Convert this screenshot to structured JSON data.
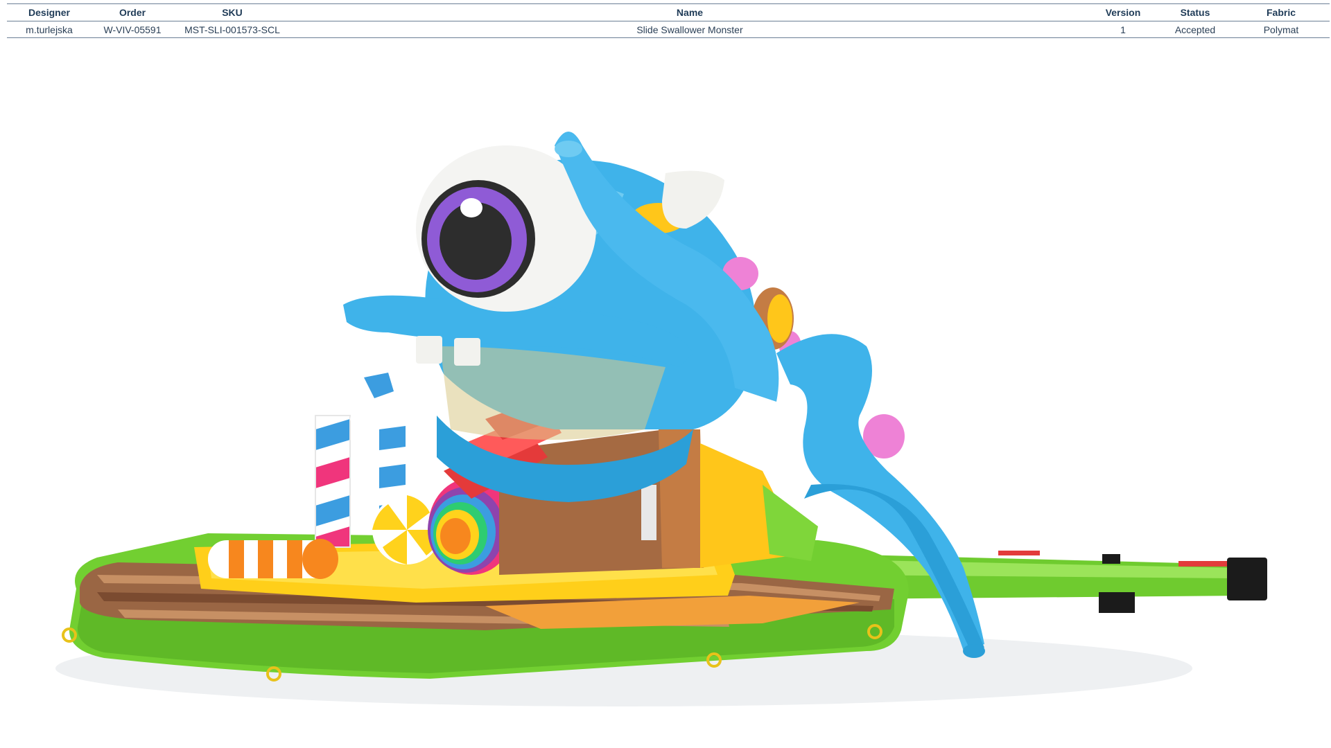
{
  "table": {
    "headers": {
      "designer": "Designer",
      "order": "Order",
      "sku": "SKU",
      "name": "Name",
      "version": "Version",
      "status": "Status",
      "fabric": "Fabric"
    },
    "row": {
      "designer": "m.turlejska",
      "order": "W-VIV-05591",
      "sku": "MST-SLI-001573-SCL",
      "name": "Slide Swallower Monster",
      "version": "1",
      "status": "Accepted",
      "fabric": "Polymat"
    }
  },
  "colors": {
    "header_text": "#1f3b57",
    "rule": "#6b7f95",
    "monster_blue": "#3fb3ea",
    "grass_green": "#7fd63a",
    "candy_pink": "#f0357c",
    "candy_orange": "#f7871e",
    "chocolate": "#8a5a3c",
    "yellow": "#ffd21c"
  }
}
